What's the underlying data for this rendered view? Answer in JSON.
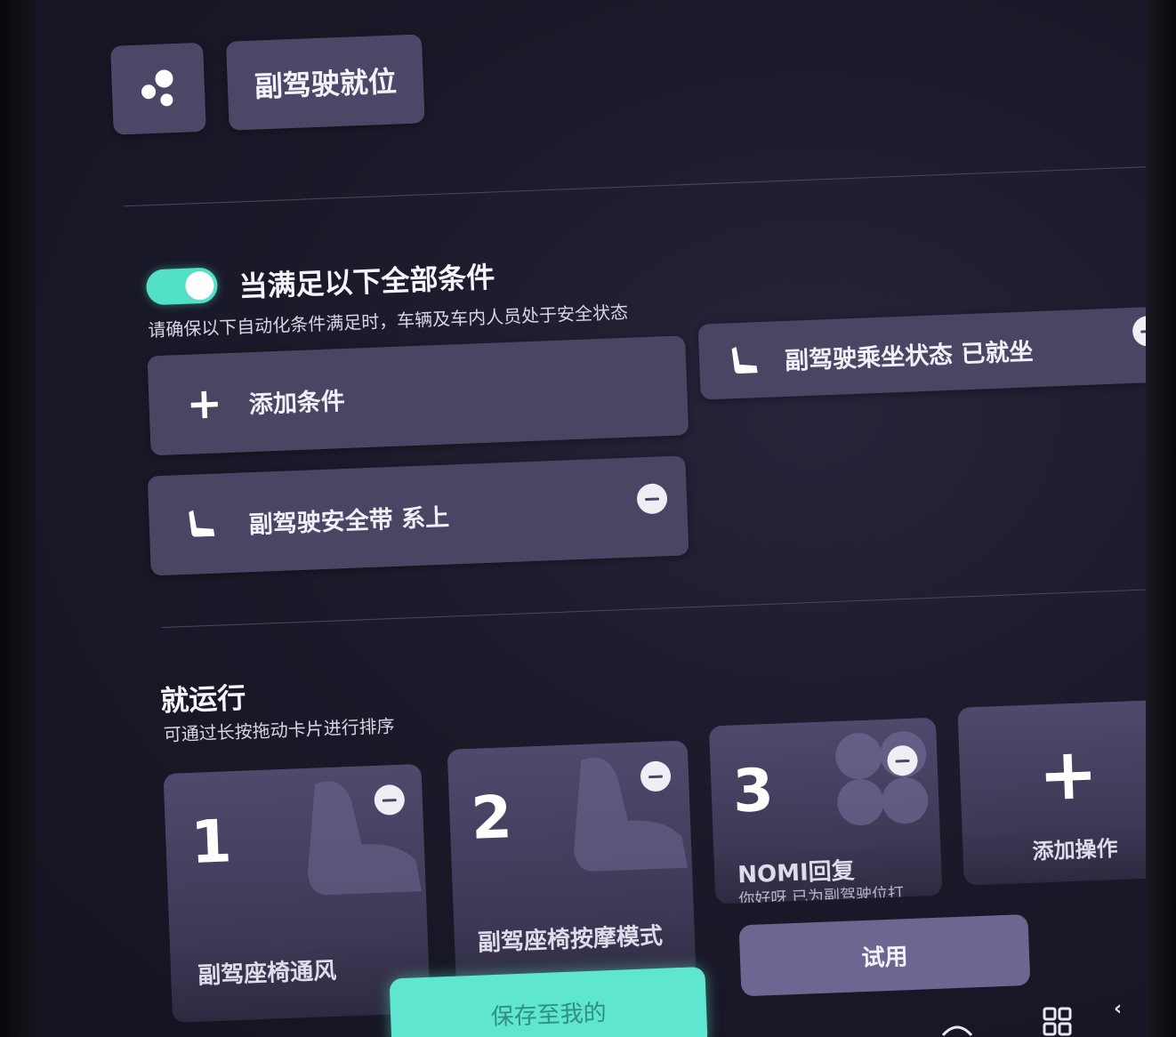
{
  "scene": {
    "title": "副驾驶就位",
    "icon": "bubbles-icon"
  },
  "conditions": {
    "heading": "当满足以下全部条件",
    "toggle_on": true,
    "note": "请确保以下自动化条件满足时，车辆及车内人员处于安全状态",
    "add_label": "添加条件",
    "items": [
      {
        "label": "副驾驶乘坐状态 已就坐",
        "icon": "seat-icon"
      },
      {
        "label": "副驾驶安全带 系上",
        "icon": "seat-icon"
      }
    ]
  },
  "actions": {
    "heading": "就运行",
    "note": "可通过长按拖动卡片进行排序",
    "cards": [
      {
        "number": "1",
        "label": "副驾座椅通风",
        "icon": "seat-icon"
      },
      {
        "number": "2",
        "label": "副驾座椅按摩模式",
        "icon": "seat-icon"
      },
      {
        "number": "3",
        "label": "NOMI回复",
        "sub": "你好呀 已为副驾驶位打",
        "icon": "fan-icon"
      }
    ],
    "add_label": "添加操作"
  },
  "footer": {
    "save_label": "保存至我的",
    "try_label": "试用"
  },
  "colors": {
    "accent": "#5fe6d0",
    "card": "#4a4563",
    "background": "#1b1a2a"
  }
}
